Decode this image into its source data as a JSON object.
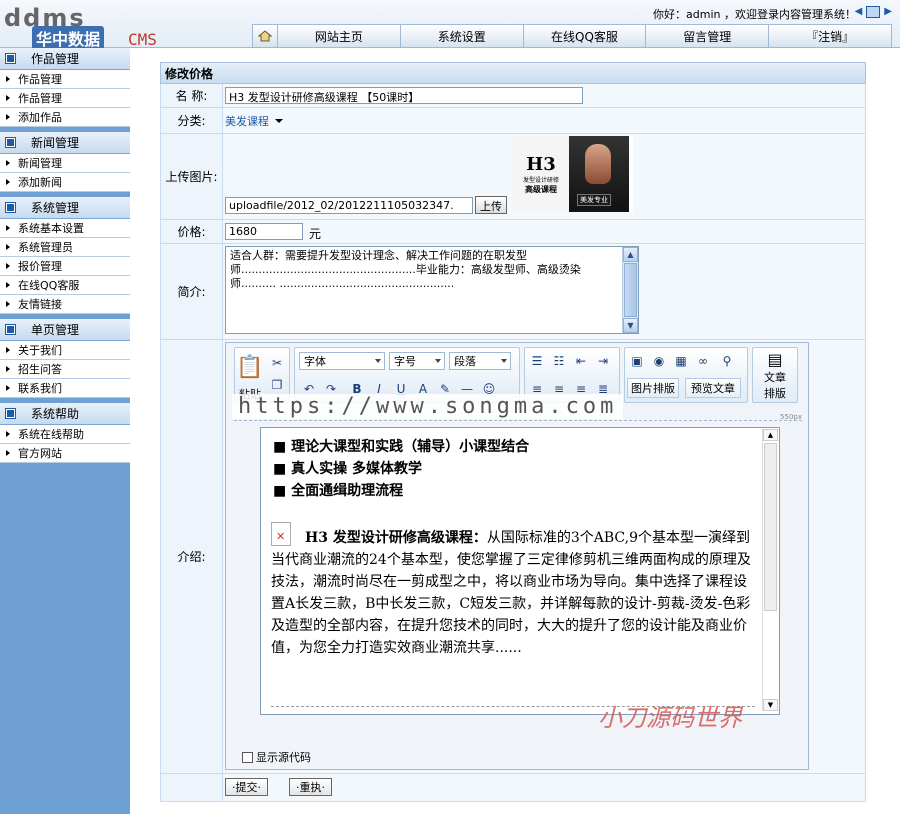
{
  "header": {
    "logo_mark": "ddms",
    "logo_cn": "华中数据",
    "logo_cms": "CMS",
    "welcome": "你好：admin ，欢迎登录内容管理系统！",
    "nav": [
      {
        "label": "网站主页"
      },
      {
        "label": "系统设置"
      },
      {
        "label": "在线QQ客服"
      },
      {
        "label": "留言管理"
      },
      {
        "label": "『注销』"
      }
    ]
  },
  "sidebar": {
    "groups": [
      {
        "title": "作品管理",
        "items": [
          "作品管理",
          "作品管理",
          "添加作品"
        ]
      },
      {
        "title": "新闻管理",
        "items": [
          "新闻管理",
          "添加新闻"
        ]
      },
      {
        "title": "系统管理",
        "items": [
          "系统基本设置",
          "系统管理员",
          "报价管理",
          "在线QQ客服",
          "友情链接"
        ]
      },
      {
        "title": "单页管理",
        "items": [
          "关于我们",
          "招生问答",
          "联系我们"
        ]
      },
      {
        "title": "系统帮助",
        "items": [
          "系统在线帮助",
          "官方网站"
        ]
      }
    ]
  },
  "form": {
    "title": "修改价格",
    "name_label": "名  称:",
    "name_value": "H3  发型设计研修高级课程         【50课时】",
    "category_label": "分类:",
    "category_value": "美发课程",
    "upload_label": "上传图片:",
    "upload_path": "uploadfile/2012_02/2012211105032347.",
    "upload_button": "上传",
    "thumb_h3": "H3",
    "thumb_sub1": "发型设计研修",
    "thumb_sub2": "高级课程",
    "thumb_tag": "美发专业",
    "price_label": "价格:",
    "price_value": "1680",
    "price_unit": "元",
    "intro_label": "简介:",
    "intro_text": "适合人群：需要提升发型设计理念、解决工作问题的在职发型师..................................................毕业能力：高级发型师、高级烫染师..........  ..................................................",
    "detail_label": "介绍:",
    "submit": "·提交·",
    "reset": "·重执·"
  },
  "editor": {
    "font_select": "字体",
    "size_select": "字号",
    "para_select": "段落",
    "paste": "粘贴",
    "image_layout": "图片排版",
    "preview": "预览文章",
    "article_layout_1": "文章",
    "article_layout_2": "排版",
    "ruler_mark": "550px",
    "bullets": [
      "■  理论大课型和实践（辅导）小课型结合",
      "■  真人实操  多媒体教学",
      "■  全面通缉助理流程"
    ],
    "body_lead": "H3    发型设计研修高级课程：",
    "body_text": "从国际标准的3个ABC,9个基本型一演绎到当代商业潮流的24个基本型，使您掌握了三定律修剪机三维两面构成的原理及技法，潮流时尚尽在一剪成型之中，将以商业市场为导向。集中选择了课程设置A长发三款，B中长发三款，C短发三款，并详解每款的设计-剪裁-烫发-色彩及造型的全部内容，在提升您技术的同时，大大的提升了您的设计能及商业价值，为您全力打造实效商业潮流共享......",
    "show_source": "显示源代码"
  },
  "watermarks": {
    "url": "https://www.songma.com",
    "brand": "小刀源码世界"
  }
}
